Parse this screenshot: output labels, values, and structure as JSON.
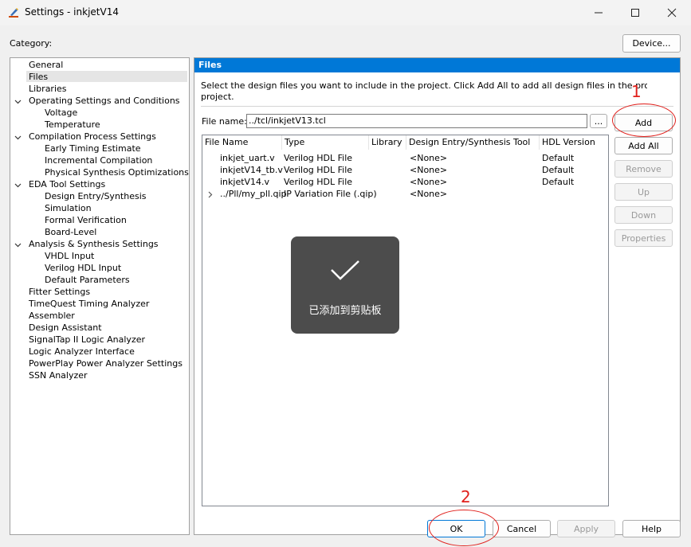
{
  "window": {
    "title": "Settings - inkjetV14",
    "minimize": "—",
    "maximize": "☐",
    "close": "✕"
  },
  "category_label": "Category:",
  "device_button": "Device...",
  "tree": [
    {
      "label": "General",
      "level": 0,
      "expandable": false,
      "selected": false
    },
    {
      "label": "Files",
      "level": 0,
      "expandable": false,
      "selected": true
    },
    {
      "label": "Libraries",
      "level": 0,
      "expandable": false,
      "selected": false
    },
    {
      "label": "Operating Settings and Conditions",
      "level": 0,
      "expandable": true,
      "selected": false
    },
    {
      "label": "Voltage",
      "level": 1,
      "expandable": false,
      "selected": false
    },
    {
      "label": "Temperature",
      "level": 1,
      "expandable": false,
      "selected": false
    },
    {
      "label": "Compilation Process Settings",
      "level": 0,
      "expandable": true,
      "selected": false
    },
    {
      "label": "Early Timing Estimate",
      "level": 1,
      "expandable": false,
      "selected": false
    },
    {
      "label": "Incremental Compilation",
      "level": 1,
      "expandable": false,
      "selected": false
    },
    {
      "label": "Physical Synthesis Optimizations",
      "level": 1,
      "expandable": false,
      "selected": false
    },
    {
      "label": "EDA Tool Settings",
      "level": 0,
      "expandable": true,
      "selected": false
    },
    {
      "label": "Design Entry/Synthesis",
      "level": 1,
      "expandable": false,
      "selected": false
    },
    {
      "label": "Simulation",
      "level": 1,
      "expandable": false,
      "selected": false
    },
    {
      "label": "Formal Verification",
      "level": 1,
      "expandable": false,
      "selected": false
    },
    {
      "label": "Board-Level",
      "level": 1,
      "expandable": false,
      "selected": false
    },
    {
      "label": "Analysis & Synthesis Settings",
      "level": 0,
      "expandable": true,
      "selected": false
    },
    {
      "label": "VHDL Input",
      "level": 1,
      "expandable": false,
      "selected": false
    },
    {
      "label": "Verilog HDL Input",
      "level": 1,
      "expandable": false,
      "selected": false
    },
    {
      "label": "Default Parameters",
      "level": 1,
      "expandable": false,
      "selected": false
    },
    {
      "label": "Fitter Settings",
      "level": 0,
      "expandable": false,
      "selected": false
    },
    {
      "label": "TimeQuest Timing Analyzer",
      "level": 0,
      "expandable": false,
      "selected": false
    },
    {
      "label": "Assembler",
      "level": 0,
      "expandable": false,
      "selected": false
    },
    {
      "label": "Design Assistant",
      "level": 0,
      "expandable": false,
      "selected": false
    },
    {
      "label": "SignalTap II Logic Analyzer",
      "level": 0,
      "expandable": false,
      "selected": false
    },
    {
      "label": "Logic Analyzer Interface",
      "level": 0,
      "expandable": false,
      "selected": false
    },
    {
      "label": "PowerPlay Power Analyzer Settings",
      "level": 0,
      "expandable": false,
      "selected": false
    },
    {
      "label": "SSN Analyzer",
      "level": 0,
      "expandable": false,
      "selected": false
    }
  ],
  "panel": {
    "title": "Files",
    "description_line1": "Select the design files you want to include in the project. Click Add All to add all design files in the project directory to the",
    "description_line2": "project.",
    "file_name_label": "File name:",
    "file_name_value": "../tcl/inkjetV13.tcl",
    "browse_label": "...",
    "columns": [
      "File Name",
      "Type",
      "Library",
      "Design Entry/Synthesis Tool",
      "HDL Version"
    ],
    "rows": [
      {
        "file": "inkjet_uart.v",
        "type": "Verilog HDL File",
        "library": "",
        "tool": "<None>",
        "hdl": "Default",
        "expandable": false
      },
      {
        "file": "inkjetV14_tb.v",
        "type": "Verilog HDL File",
        "library": "",
        "tool": "<None>",
        "hdl": "Default",
        "expandable": false
      },
      {
        "file": "inkjetV14.v",
        "type": "Verilog HDL File",
        "library": "",
        "tool": "<None>",
        "hdl": "Default",
        "expandable": false
      },
      {
        "file": "../Pll/my_pll.qip",
        "type": "IP Variation File (.qip)",
        "library": "",
        "tool": "<None>",
        "hdl": "",
        "expandable": true
      }
    ],
    "buttons": {
      "add": "Add",
      "add_all": "Add All",
      "remove": "Remove",
      "up": "Up",
      "down": "Down",
      "properties": "Properties"
    }
  },
  "footer": {
    "ok": "OK",
    "cancel": "Cancel",
    "apply": "Apply",
    "help": "Help"
  },
  "annotations": {
    "marker1": "1",
    "marker2": "2",
    "color": "#e0201c"
  },
  "toast": {
    "message": "已添加到剪贴板"
  },
  "accent": "#0078d7"
}
